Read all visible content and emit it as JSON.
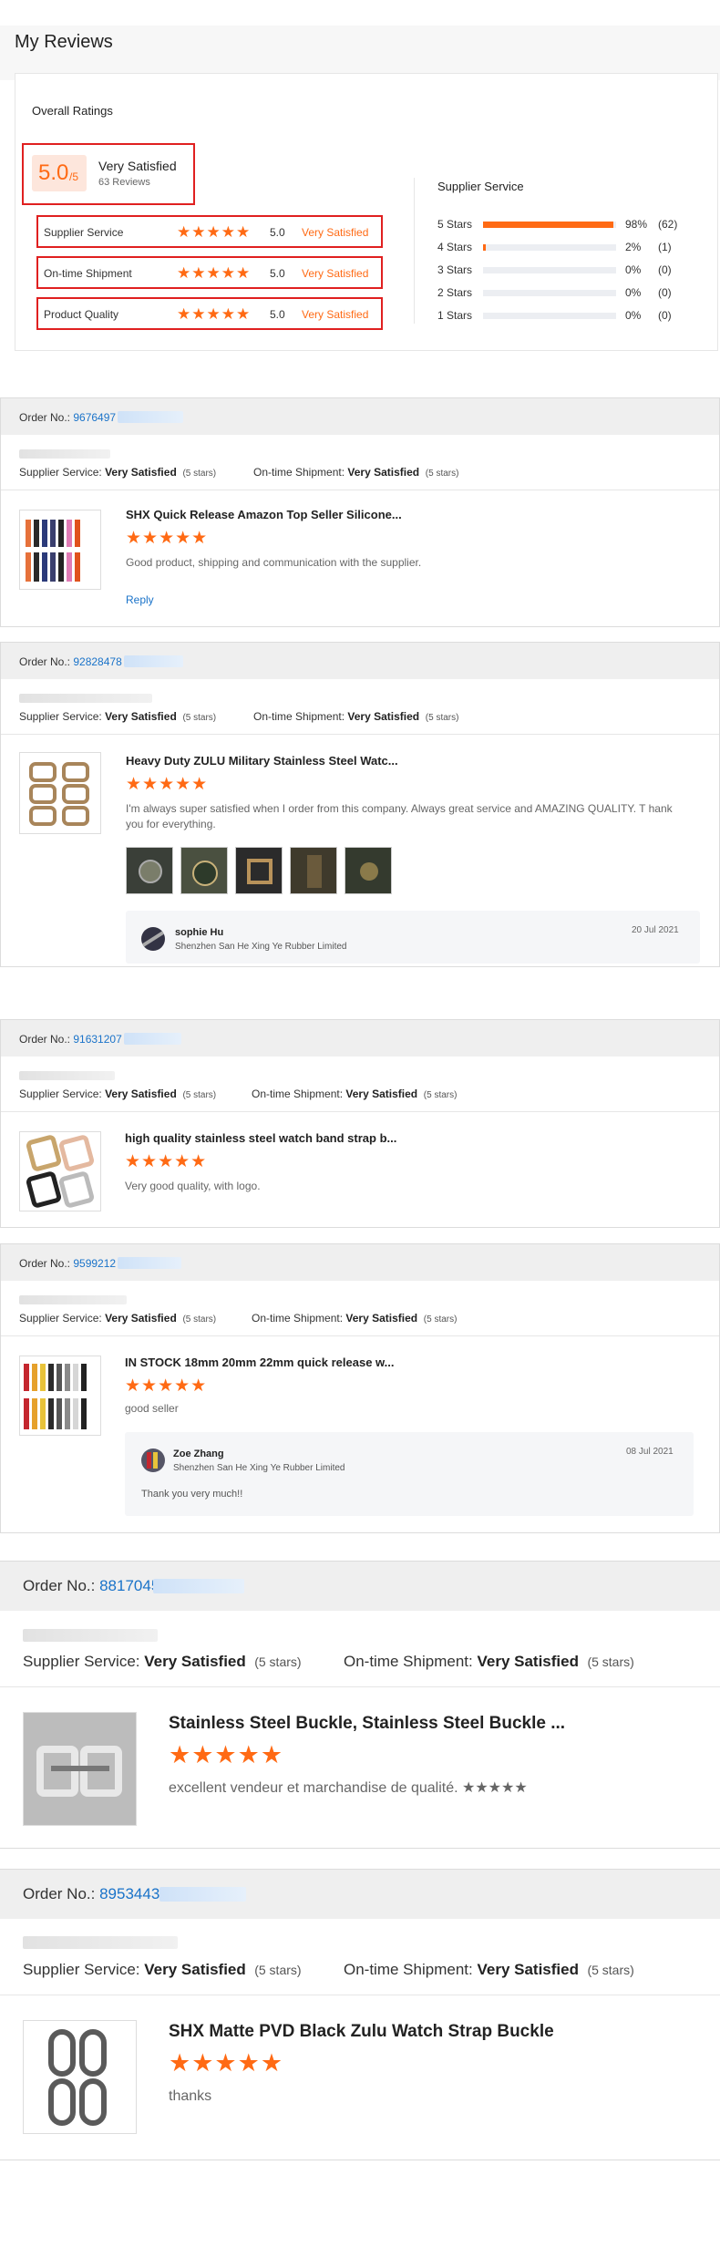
{
  "header": {
    "title": "My Reviews"
  },
  "overall": {
    "title": "Overall Ratings",
    "score": "5.0",
    "score_suffix": "/5",
    "score_label": "Very Satisfied",
    "review_count": "63 Reviews",
    "rows": [
      {
        "label": "Supplier Service",
        "stars": "★★★★★",
        "value": "5.0",
        "text": "Very Satisfied"
      },
      {
        "label": "On-time Shipment",
        "stars": "★★★★★",
        "value": "5.0",
        "text": "Very Satisfied"
      },
      {
        "label": "Product Quality",
        "stars": "★★★★★",
        "value": "5.0",
        "text": "Very Satisfied"
      }
    ]
  },
  "distribution": {
    "title": "Supplier Service",
    "rows": [
      {
        "label": "5 Stars",
        "pct": "98%",
        "count": "(62)",
        "fill": 0.98
      },
      {
        "label": "4 Stars",
        "pct": "2%",
        "count": "(1)",
        "fill": 0.02
      },
      {
        "label": "3 Stars",
        "pct": "0%",
        "count": "(0)",
        "fill": 0
      },
      {
        "label": "2 Stars",
        "pct": "0%",
        "count": "(0)",
        "fill": 0
      },
      {
        "label": "1 Stars",
        "pct": "0%",
        "count": "(0)",
        "fill": 0
      }
    ]
  },
  "common": {
    "order_label": "Order No.:",
    "supplier_service_label": "Supplier Service:",
    "ontime_label": "On-time Shipment:",
    "very_satisfied": "Very Satisfied",
    "five_stars": "(5 stars)",
    "stars": "★★★★★",
    "reply": "Reply",
    "reply_company": "Shenzhen San He Xing Ye Rubber Limited"
  },
  "reviews": [
    {
      "order_no": "9676497",
      "product_title": "SHX Quick Release Amazon Top Seller Silicone...",
      "comment": "Good product, shipping and communication with the supplier.",
      "has_reply_link": true
    },
    {
      "order_no": "92828478",
      "product_title": "Heavy Duty ZULU Military Stainless Steel Watc...",
      "comment": "I'm always super satisfied when I order from this company. Always great service and AMAZING QUALITY. T hank you for everything.",
      "reply_name": "sophie Hu",
      "reply_date": "20 Jul 2021"
    },
    {
      "order_no": "91631207",
      "product_title": "high quality stainless steel watch band strap b...",
      "comment": "Very good quality, with logo."
    },
    {
      "order_no": "9599212",
      "product_title": "IN STOCK 18mm 20mm 22mm quick release w...",
      "comment": "good seller",
      "reply_name": "Zoe Zhang",
      "reply_date": "08 Jul 2021",
      "reply_text": "Thank you very much!!"
    },
    {
      "order_no": "8817045",
      "product_title": "Stainless Steel Buckle, Stainless Steel Buckle ...",
      "comment": "excellent vendeur et marchandise de qualité. ★★★★★"
    },
    {
      "order_no": "8953443",
      "product_title": "SHX Matte PVD Black Zulu Watch Strap Buckle",
      "comment": "thanks"
    }
  ]
}
